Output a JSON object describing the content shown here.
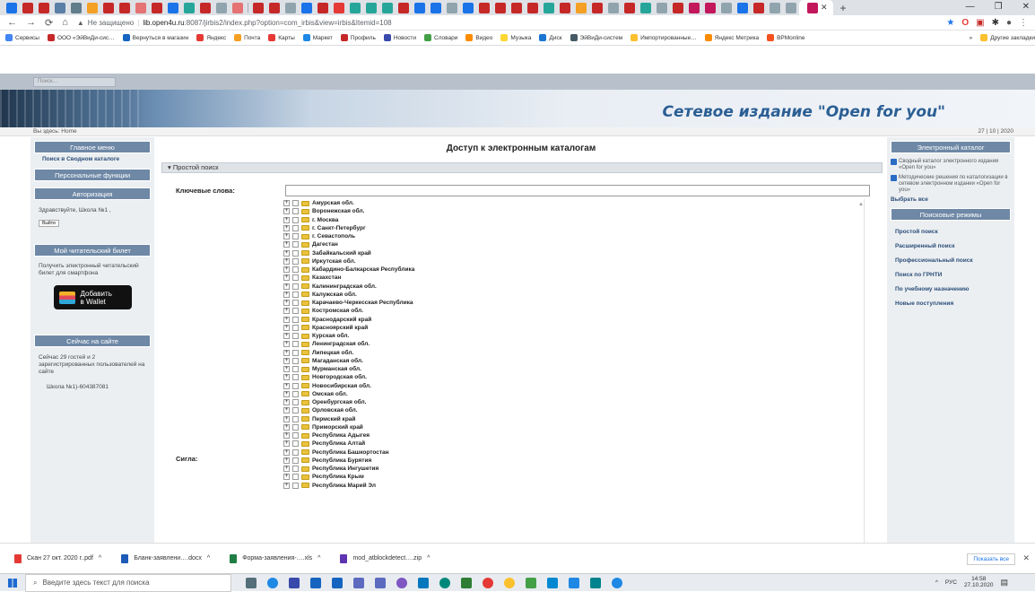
{
  "browser": {
    "insecure_label": "Не защищено",
    "url_domain": "lib.open4u.ru",
    "url_rest": ":8087/jirbis2/index.php?option=com_irbis&view=irbis&Itemid=108",
    "bookmarks": [
      "Сервисы",
      "ООО «ЭйВиДи-сис…",
      "Вернуться в магазин",
      "Яндекс",
      "Почта",
      "Карты",
      "Маркет",
      "Профиль",
      "Новости",
      "Словари",
      "Видео",
      "Музыка",
      "Диск",
      "ЭйВиДи-систем",
      "Импортированные…",
      "Яндекс Метрика",
      "BPMonline"
    ],
    "bookmarks_more": "»",
    "other_bookmarks": "Другие закладки"
  },
  "page": {
    "search_placeholder": "Поиск…",
    "site_title": "Сетевое издание \"Open for you\"",
    "breadcrumb": "Вы здесь: Home",
    "date": "27 | 10 | 2020"
  },
  "left": {
    "main_menu": "Главное меню",
    "menu_link": "Поиск в Сводном каталоге",
    "personal": "Персональные функции",
    "auth": "Авторизация",
    "greeting": "Здравствуйте, Школа №1 ,",
    "logout": "Выйти",
    "ticket_head": "Мой читательский билет",
    "ticket_text": "Получить электронный читательский билет для смартфона",
    "wallet_line1": "Добавить",
    "wallet_line2": "в Wallet",
    "online_head": "Сейчас на сайте",
    "online_text": "Сейчас 29 гостей и 2 зарегистрированных пользователей на сайте",
    "online_user": "Школа №1)-604387081"
  },
  "center": {
    "title": "Доступ к электронным каталогам",
    "simple_search": "Простой поиск",
    "keywords_label": "Ключевые слова:",
    "sigla_label": "Сигла:",
    "tree": [
      "Амурская обл.",
      "Воронежская обл.",
      "г. Москва",
      "г. Санкт-Петербург",
      "г. Севастополь",
      "Дагестан",
      "Забайкальский край",
      "Иркутская обл.",
      "Кабардино-Балкарская Республика",
      "Казахстан",
      "Калининградская обл.",
      "Калужская обл.",
      "Карачаево-Черкесская Республика",
      "Костромская обл.",
      "Краснодарский край",
      "Красноярский край",
      "Курская обл.",
      "Ленинградская обл.",
      "Липецкая обл.",
      "Магаданская обл.",
      "Мурманская обл.",
      "Новгородская обл.",
      "Новосибирская обл.",
      "Омская обл.",
      "Оренбургская обл.",
      "Орловская обл.",
      "Пермский край",
      "Приморский край",
      "Республика Адыгея",
      "Республика Алтай",
      "Республика Башкортостан",
      "Республика Бурятия",
      "Республика Ингушетия",
      "Республика Крым",
      "Республика Марий Эл"
    ]
  },
  "right": {
    "ecatalog_head": "Электронный каталог",
    "check1": "Сводный каталог электронного издания «Open for you»",
    "check2": "Методические решения по каталогизации в сетевом электронном издании «Open for you»",
    "select_all": "Выбрать все",
    "modes_head": "Поисковые режимы",
    "modes": [
      "Простой поиск",
      "Расширенный поиск",
      "Профессиональный поиск",
      "Поиск по ГРНТИ",
      "По учебному назначению",
      "Новые поступления"
    ]
  },
  "downloads": {
    "items": [
      "Скан 27 окт. 2020 г..pdf",
      "Бланк-заявлени….docx",
      "Форма-заявления-….xls",
      "mod_atblockdetect….zip"
    ],
    "show_all": "Показать все"
  },
  "taskbar": {
    "search_placeholder": "Введите здесь текст для поиска",
    "lang": "РУС",
    "time": "14:58",
    "date": "27.10.2020"
  }
}
